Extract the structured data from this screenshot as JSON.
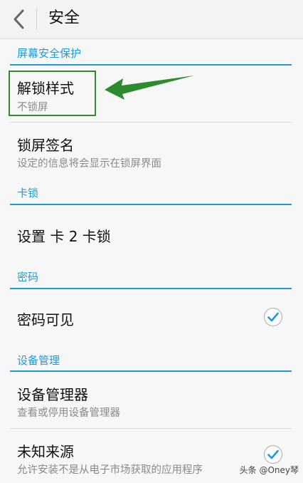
{
  "header": {
    "title": "安全"
  },
  "sections": [
    {
      "title": "屏幕安全保护"
    },
    {
      "title": "卡锁"
    },
    {
      "title": "密码"
    },
    {
      "title": "设备管理"
    }
  ],
  "items": {
    "unlock_style": {
      "title": "解锁样式",
      "subtitle": "不锁屏"
    },
    "lockscreen_signature": {
      "title": "锁屏签名",
      "subtitle": "设定的信息将会显示在锁屏界面"
    },
    "card2_lock": {
      "title": "设置 卡 2 卡锁"
    },
    "password_visible": {
      "title": "密码可见",
      "checked": true
    },
    "device_admin": {
      "title": "设备管理器",
      "subtitle": "查看或停用设备管理器"
    },
    "unknown_sources": {
      "title": "未知来源",
      "subtitle": "允许安装不是从电子市场获取的应用程序",
      "checked": true
    }
  },
  "watermark": "头条 @Oney琴",
  "colors": {
    "accent": "#1e9bd6",
    "annotation": "#2e8b2e"
  }
}
